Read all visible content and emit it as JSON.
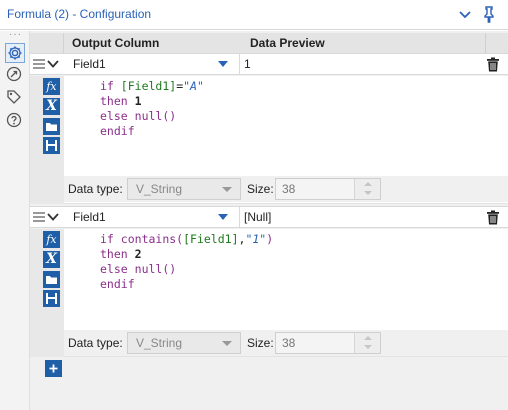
{
  "window": {
    "title": "Formula (2) - Configuration"
  },
  "header": {
    "output_column": "Output Column",
    "data_preview": "Data Preview"
  },
  "rows": [
    {
      "field": "Field1",
      "preview": "1",
      "code": {
        "line1_kw": "if",
        "line1_field": "[Field1]",
        "line1_op": "=",
        "line1_str": "\"A\"",
        "line2_kw": "then",
        "line2_num": "1",
        "line3_kw": "else",
        "line3_fn": "null()",
        "line4_kw": "endif"
      },
      "data_type_label": "Data type:",
      "data_type": "V_String",
      "size_label": "Size:",
      "size": "38"
    },
    {
      "field": "Field1",
      "preview": "[Null]",
      "code": {
        "line1_kw": "if",
        "line1_fn": "contains(",
        "line1_field": "[Field1]",
        "line1_sep": ",",
        "line1_str": "\"1\"",
        "line1_close": ")",
        "line2_kw": "then",
        "line2_num": "2",
        "line3_kw": "else",
        "line3_fn": "null()",
        "line4_kw": "endif"
      },
      "data_type_label": "Data type:",
      "data_type": "V_String",
      "size_label": "Size:",
      "size": "38"
    }
  ],
  "icons": {
    "collapse": "chevron-down-icon",
    "pin": "pin-icon",
    "settings": "gear-icon",
    "connection": "connection-icon",
    "tag": "tag-icon",
    "help": "help-icon",
    "delete": "trash-icon",
    "function": "fx-icon",
    "variable": "variable-icon",
    "open": "folder-icon",
    "save": "save-icon",
    "add": "plus-icon"
  },
  "colors": {
    "accent": "#2a62b7",
    "tool_blue": "#1f5fa8"
  }
}
